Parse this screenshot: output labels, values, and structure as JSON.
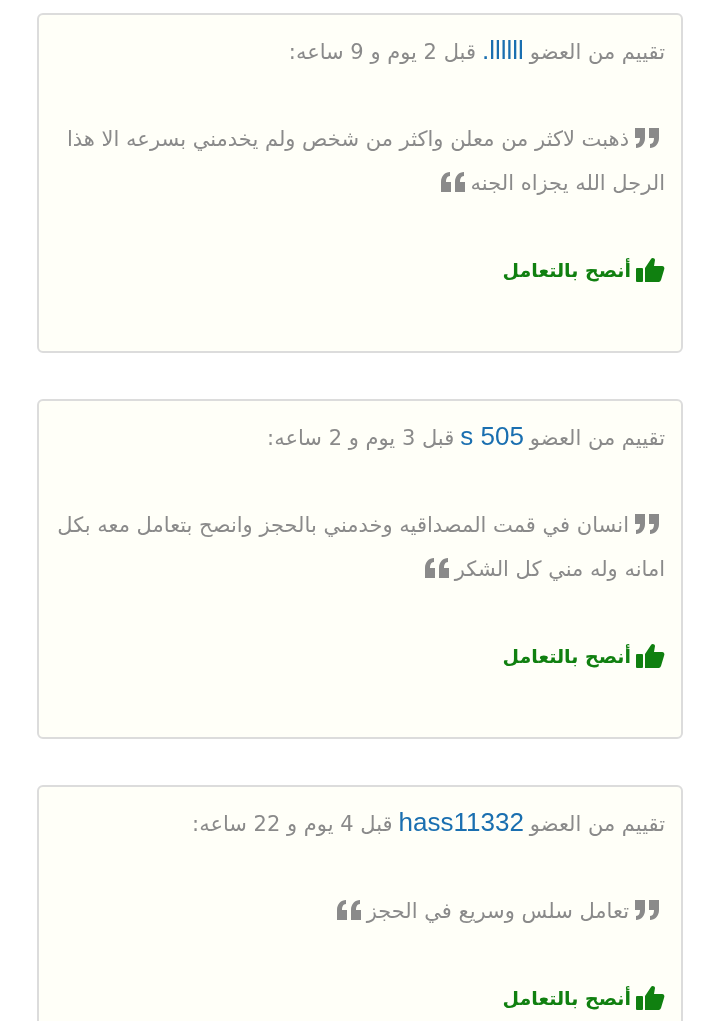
{
  "reviews": [
    {
      "prefix": "تقييم من العضو",
      "member": "llllll.",
      "suffix": "قبل 2 يوم و 9 ساعه:",
      "comment": "ذهبت لاكثر من معلن واكثر من شخص ولم يخدمني بسرعه الا هذا الرجل الله يجزاه الجنه",
      "recommendation": "أنصح بالتعامل",
      "recommended": true
    },
    {
      "prefix": "تقييم من العضو",
      "member": "s 505",
      "suffix": "قبل 3 يوم و 2 ساعه:",
      "comment": "انسان في قمت المصداقيه وخدمني بالحجز وانصح بتعامل معه بكل امانه وله مني كل الشكر",
      "recommendation": "أنصح بالتعامل",
      "recommended": true
    },
    {
      "prefix": "تقييم من العضو",
      "member": "hass11332",
      "suffix": "قبل 4 يوم و 22 ساعه:",
      "comment": "تعامل سلس وسريع في الحجز",
      "recommendation": "أنصح بالتعامل",
      "recommended": true
    }
  ]
}
